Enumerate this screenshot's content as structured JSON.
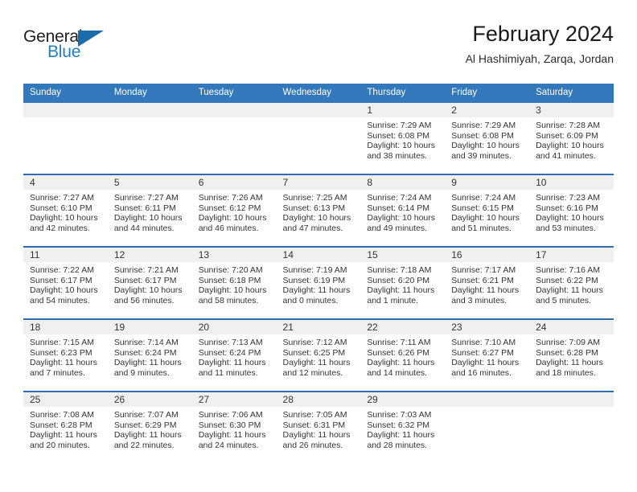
{
  "brand": {
    "word_one": "General",
    "word_two": "Blue",
    "triangle_icon": "triangle-logo-icon",
    "color_dark": "#231f20",
    "color_blue": "#1f7fc4"
  },
  "header": {
    "title": "February 2024",
    "subtitle": "Al Hashimiyah, Zarqa, Jordan"
  },
  "theme": {
    "header_blue": "#3478bc",
    "separator_blue": "#2f6daf",
    "daynum_band": "#f0f0f0",
    "text": "#333333"
  },
  "calendar": {
    "day_headers": [
      "Sunday",
      "Monday",
      "Tuesday",
      "Wednesday",
      "Thursday",
      "Friday",
      "Saturday"
    ],
    "labels": {
      "sunrise": "Sunrise:",
      "sunset": "Sunset:",
      "daylight": "Daylight:"
    },
    "weeks": [
      [
        {
          "day": "",
          "blank": true
        },
        {
          "day": "",
          "blank": true
        },
        {
          "day": "",
          "blank": true
        },
        {
          "day": "",
          "blank": true
        },
        {
          "day": "1",
          "sunrise": "Sunrise: 7:29 AM",
          "sunset": "Sunset: 6:08 PM",
          "daylight": "Daylight: 10 hours and 38 minutes."
        },
        {
          "day": "2",
          "sunrise": "Sunrise: 7:29 AM",
          "sunset": "Sunset: 6:08 PM",
          "daylight": "Daylight: 10 hours and 39 minutes."
        },
        {
          "day": "3",
          "sunrise": "Sunrise: 7:28 AM",
          "sunset": "Sunset: 6:09 PM",
          "daylight": "Daylight: 10 hours and 41 minutes."
        }
      ],
      [
        {
          "day": "4",
          "sunrise": "Sunrise: 7:27 AM",
          "sunset": "Sunset: 6:10 PM",
          "daylight": "Daylight: 10 hours and 42 minutes."
        },
        {
          "day": "5",
          "sunrise": "Sunrise: 7:27 AM",
          "sunset": "Sunset: 6:11 PM",
          "daylight": "Daylight: 10 hours and 44 minutes."
        },
        {
          "day": "6",
          "sunrise": "Sunrise: 7:26 AM",
          "sunset": "Sunset: 6:12 PM",
          "daylight": "Daylight: 10 hours and 46 minutes."
        },
        {
          "day": "7",
          "sunrise": "Sunrise: 7:25 AM",
          "sunset": "Sunset: 6:13 PM",
          "daylight": "Daylight: 10 hours and 47 minutes."
        },
        {
          "day": "8",
          "sunrise": "Sunrise: 7:24 AM",
          "sunset": "Sunset: 6:14 PM",
          "daylight": "Daylight: 10 hours and 49 minutes."
        },
        {
          "day": "9",
          "sunrise": "Sunrise: 7:24 AM",
          "sunset": "Sunset: 6:15 PM",
          "daylight": "Daylight: 10 hours and 51 minutes."
        },
        {
          "day": "10",
          "sunrise": "Sunrise: 7:23 AM",
          "sunset": "Sunset: 6:16 PM",
          "daylight": "Daylight: 10 hours and 53 minutes."
        }
      ],
      [
        {
          "day": "11",
          "sunrise": "Sunrise: 7:22 AM",
          "sunset": "Sunset: 6:17 PM",
          "daylight": "Daylight: 10 hours and 54 minutes."
        },
        {
          "day": "12",
          "sunrise": "Sunrise: 7:21 AM",
          "sunset": "Sunset: 6:17 PM",
          "daylight": "Daylight: 10 hours and 56 minutes."
        },
        {
          "day": "13",
          "sunrise": "Sunrise: 7:20 AM",
          "sunset": "Sunset: 6:18 PM",
          "daylight": "Daylight: 10 hours and 58 minutes."
        },
        {
          "day": "14",
          "sunrise": "Sunrise: 7:19 AM",
          "sunset": "Sunset: 6:19 PM",
          "daylight": "Daylight: 11 hours and 0 minutes."
        },
        {
          "day": "15",
          "sunrise": "Sunrise: 7:18 AM",
          "sunset": "Sunset: 6:20 PM",
          "daylight": "Daylight: 11 hours and 1 minute."
        },
        {
          "day": "16",
          "sunrise": "Sunrise: 7:17 AM",
          "sunset": "Sunset: 6:21 PM",
          "daylight": "Daylight: 11 hours and 3 minutes."
        },
        {
          "day": "17",
          "sunrise": "Sunrise: 7:16 AM",
          "sunset": "Sunset: 6:22 PM",
          "daylight": "Daylight: 11 hours and 5 minutes."
        }
      ],
      [
        {
          "day": "18",
          "sunrise": "Sunrise: 7:15 AM",
          "sunset": "Sunset: 6:23 PM",
          "daylight": "Daylight: 11 hours and 7 minutes."
        },
        {
          "day": "19",
          "sunrise": "Sunrise: 7:14 AM",
          "sunset": "Sunset: 6:24 PM",
          "daylight": "Daylight: 11 hours and 9 minutes."
        },
        {
          "day": "20",
          "sunrise": "Sunrise: 7:13 AM",
          "sunset": "Sunset: 6:24 PM",
          "daylight": "Daylight: 11 hours and 11 minutes."
        },
        {
          "day": "21",
          "sunrise": "Sunrise: 7:12 AM",
          "sunset": "Sunset: 6:25 PM",
          "daylight": "Daylight: 11 hours and 12 minutes."
        },
        {
          "day": "22",
          "sunrise": "Sunrise: 7:11 AM",
          "sunset": "Sunset: 6:26 PM",
          "daylight": "Daylight: 11 hours and 14 minutes."
        },
        {
          "day": "23",
          "sunrise": "Sunrise: 7:10 AM",
          "sunset": "Sunset: 6:27 PM",
          "daylight": "Daylight: 11 hours and 16 minutes."
        },
        {
          "day": "24",
          "sunrise": "Sunrise: 7:09 AM",
          "sunset": "Sunset: 6:28 PM",
          "daylight": "Daylight: 11 hours and 18 minutes."
        }
      ],
      [
        {
          "day": "25",
          "sunrise": "Sunrise: 7:08 AM",
          "sunset": "Sunset: 6:28 PM",
          "daylight": "Daylight: 11 hours and 20 minutes."
        },
        {
          "day": "26",
          "sunrise": "Sunrise: 7:07 AM",
          "sunset": "Sunset: 6:29 PM",
          "daylight": "Daylight: 11 hours and 22 minutes."
        },
        {
          "day": "27",
          "sunrise": "Sunrise: 7:06 AM",
          "sunset": "Sunset: 6:30 PM",
          "daylight": "Daylight: 11 hours and 24 minutes."
        },
        {
          "day": "28",
          "sunrise": "Sunrise: 7:05 AM",
          "sunset": "Sunset: 6:31 PM",
          "daylight": "Daylight: 11 hours and 26 minutes."
        },
        {
          "day": "29",
          "sunrise": "Sunrise: 7:03 AM",
          "sunset": "Sunset: 6:32 PM",
          "daylight": "Daylight: 11 hours and 28 minutes."
        },
        {
          "day": "",
          "blank": true
        },
        {
          "day": "",
          "blank": true
        }
      ]
    ]
  }
}
